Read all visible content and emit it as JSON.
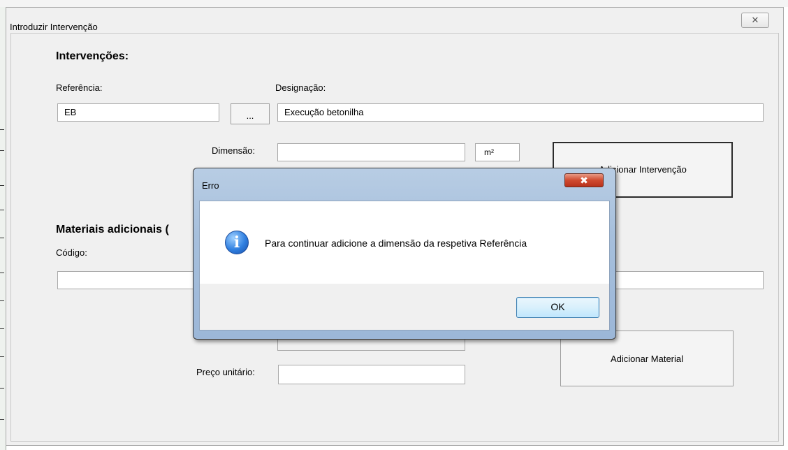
{
  "userform": {
    "title": "Introduzir Intervenção",
    "close_glyph": "✕",
    "interventions": {
      "heading": "Intervenções:",
      "reference_label": "Referência:",
      "reference_value": "EB",
      "browse_label": "...",
      "designation_label": "Designação:",
      "designation_value": "Execução betonilha",
      "dimension_label": "Dimensão:",
      "dimension_value": "",
      "unit_value": "m²",
      "add_intervention_label": "Adicionar Intervenção"
    },
    "materials": {
      "heading": "Materiais adicionais (",
      "code_label": "Código:",
      "code_value": "",
      "unit_price_label": "Preço unitário:",
      "unit_price_value": "",
      "add_material_label": "Adicionar Material"
    }
  },
  "error_dialog": {
    "title": "Erro",
    "close_glyph": "✖",
    "icon": "info-icon",
    "icon_glyph": "i",
    "message": "Para continuar adicione a dimensão da respetiva Referência",
    "ok_label": "OK"
  }
}
